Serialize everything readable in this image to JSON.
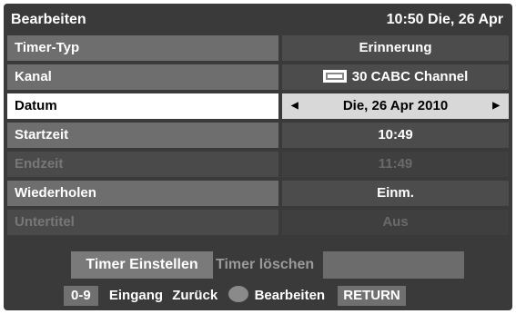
{
  "header": {
    "title": "Bearbeiten",
    "datetime": "10:50 Die, 26 Apr"
  },
  "rows": [
    {
      "label": "Timer-Typ",
      "value": "Erinnerung"
    },
    {
      "label": "Kanal",
      "value": "30 CABC Channel"
    },
    {
      "label": "Datum",
      "value": "Die, 26 Apr 2010"
    },
    {
      "label": "Startzeit",
      "value": "10:49"
    },
    {
      "label": "Endzeit",
      "value": "11:49"
    },
    {
      "label": "Wiederholen",
      "value": "Einm."
    },
    {
      "label": "Untertitel",
      "value": "Aus"
    }
  ],
  "buttons": {
    "set": "Timer Einstellen",
    "delete": "Timer löschen"
  },
  "footer": {
    "key_09": "0-9",
    "input_label": "Eingang",
    "nav_label": "Zurück",
    "edit_label": "Bearbeiten",
    "return_label": "RETURN"
  },
  "icons": {
    "channel": "tv-channel-icon",
    "arrow_left": "left-arrow-icon",
    "arrow_right": "right-arrow-icon",
    "nav": "nav-wheel-icon"
  },
  "colors": {
    "panel": "#3a3a3a",
    "selected_row": "#ffffff",
    "row": "#6e6e6e"
  }
}
